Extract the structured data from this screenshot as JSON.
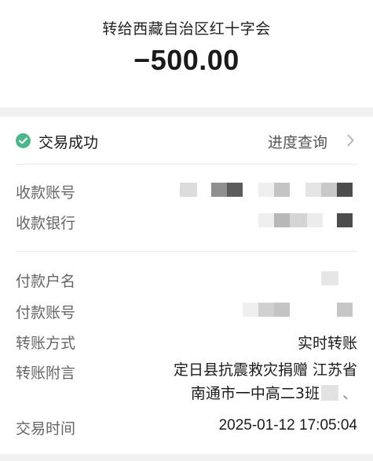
{
  "header": {
    "payee": "转给西藏自治区红十字会",
    "amount": "−500.00"
  },
  "status": {
    "text": "交易成功",
    "progress_link": "进度查询",
    "icon": "check-circle-icon",
    "color": "#4cb58a"
  },
  "details": {
    "receiving_account_label": "收款账号",
    "receiving_bank_label": "收款银行",
    "payer_name_label": "付款户名",
    "payer_account_label": "付款账号",
    "method_label": "转账方式",
    "method_value": "实时转账",
    "note_label": "转账附言",
    "note_line1": "定日县抗震救灾捐赠 江苏省",
    "note_line2": "南通市一中高二3班",
    "note_trailing": "、",
    "time_label": "交易时间",
    "time_value": "2025-01-12 17:05:04"
  }
}
